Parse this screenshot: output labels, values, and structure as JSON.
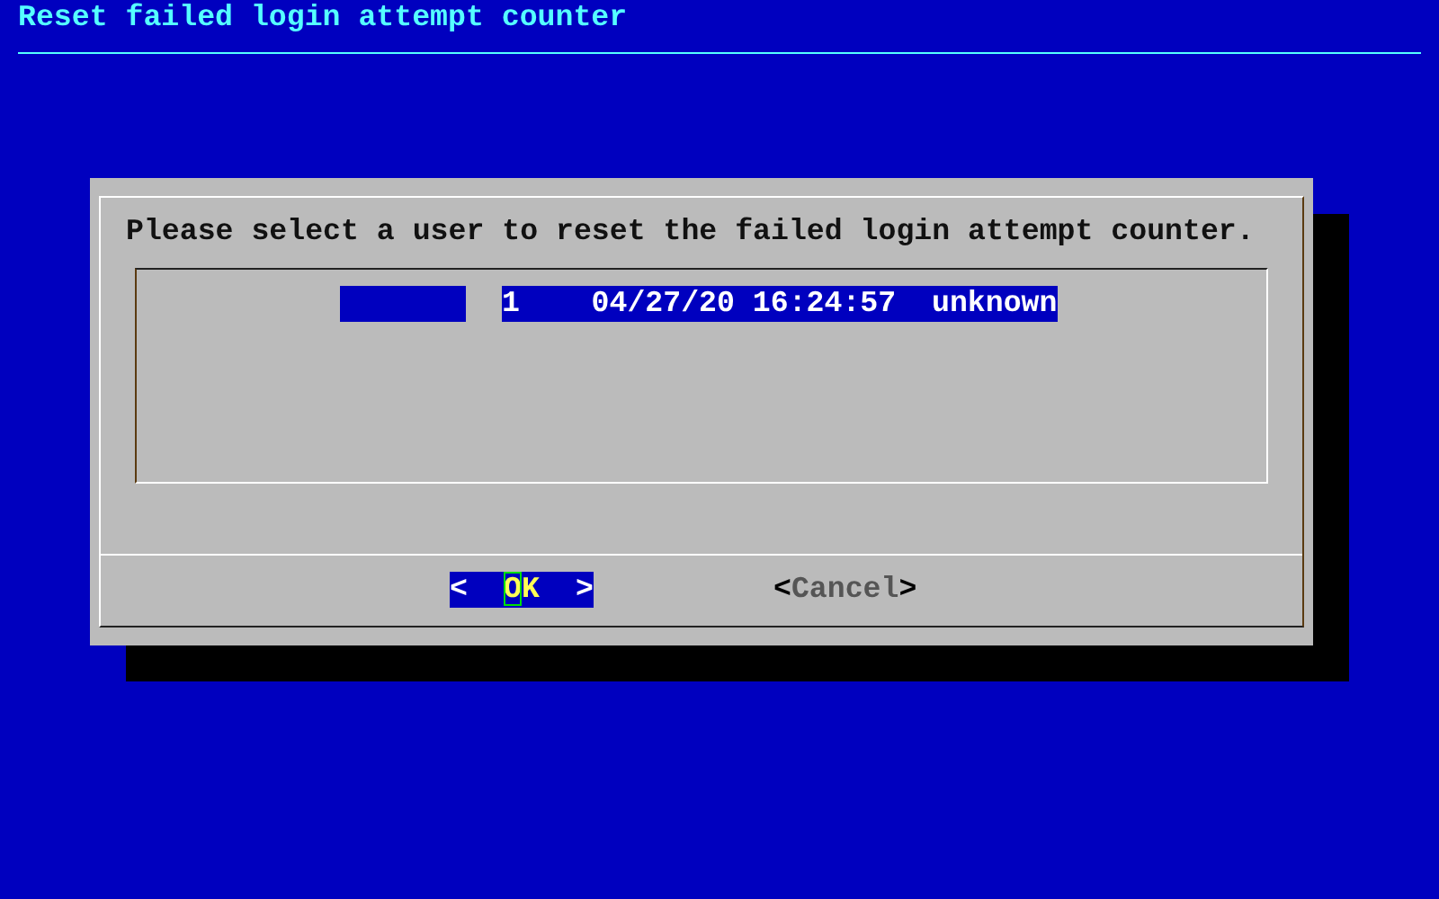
{
  "screen": {
    "title": "Reset failed login attempt counter"
  },
  "dialog": {
    "prompt": "Please select a user to reset the failed login attempt counter.",
    "items": [
      {
        "text": "1    04/27/20 16:24:57  unknown",
        "selected": true
      }
    ],
    "buttons": [
      {
        "open": "<",
        "label": "OK",
        "close": ">",
        "selected": true
      },
      {
        "open": "<",
        "label": "Cancel",
        "close": ">",
        "selected": false
      }
    ]
  }
}
